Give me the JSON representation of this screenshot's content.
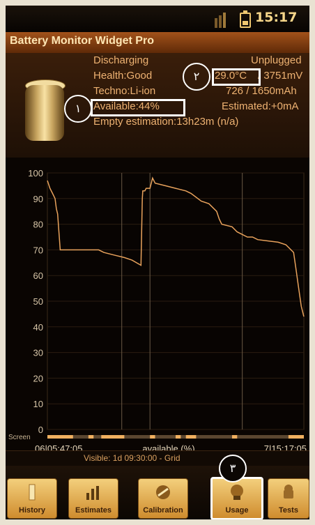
{
  "status": {
    "time": "15:17"
  },
  "app": {
    "title": "Battery Monitor Widget Pro"
  },
  "info": {
    "state": "Discharging",
    "plug": "Unplugged",
    "health": "Health:Good",
    "temperature": "29.0°C",
    "voltage": "/ 3751mV",
    "techno": "Techno:Li-ion",
    "capacity": "726 / 1650mAh",
    "available": "Available:44%",
    "estimated": "Estimated:+0mA",
    "empty_estimation": "Empty estimation:13h23m (n/a)"
  },
  "annotations": {
    "one": "١",
    "two": "٢",
    "three": "٣"
  },
  "chart_data": {
    "type": "line",
    "ylim": [
      0,
      100
    ],
    "y_ticks": [
      "0",
      "10",
      "20",
      "30",
      "40",
      "50",
      "60",
      "70",
      "80",
      "90",
      "100"
    ],
    "x_start_label": "06|05:47:05",
    "x_center_label": "available (%)",
    "x_end_label": "7|15:17:05",
    "row_label": "Screen",
    "x": [
      0,
      0.01,
      0.02,
      0.03,
      0.035,
      0.04,
      0.05,
      0.06,
      0.07,
      0.075,
      0.1,
      0.15,
      0.2,
      0.22,
      0.26,
      0.3,
      0.33,
      0.365,
      0.37,
      0.372,
      0.38,
      0.385,
      0.4,
      0.41,
      0.42,
      0.46,
      0.5,
      0.54,
      0.56,
      0.6,
      0.63,
      0.66,
      0.67,
      0.68,
      0.72,
      0.74,
      0.76,
      0.78,
      0.8,
      0.82,
      0.9,
      0.93,
      0.96,
      0.97,
      0.98,
      0.99,
      1.0
    ],
    "y": [
      97,
      94,
      92,
      90,
      86,
      84,
      70,
      70,
      70,
      70,
      70,
      70,
      70,
      69,
      68,
      67,
      66,
      64,
      90,
      93,
      93,
      94,
      94,
      98,
      96,
      95,
      94,
      93,
      92,
      89,
      88,
      85,
      82,
      80,
      79,
      77,
      76,
      75,
      75,
      74,
      73,
      72,
      69,
      62,
      55,
      48,
      44
    ],
    "series_color": "#e8a25c",
    "gridlines": true,
    "screen_segments": [
      [
        0.0,
        0.1
      ],
      [
        0.16,
        0.18
      ],
      [
        0.21,
        0.3
      ],
      [
        0.4,
        0.42
      ],
      [
        0.5,
        0.52
      ],
      [
        0.54,
        0.58
      ],
      [
        0.72,
        0.74
      ],
      [
        0.94,
        1.0
      ]
    ]
  },
  "footer": {
    "visible": "Visible: 1d 09:30:00 - Grid"
  },
  "tabs": [
    {
      "label": "History",
      "icon": "bar-icon"
    },
    {
      "label": "Estimates",
      "icon": "chart-icon"
    },
    {
      "label": "Calibration",
      "icon": "calibration-icon"
    },
    {
      "label": "Usage",
      "icon": "usage-icon"
    },
    {
      "label": "Tests",
      "icon": "android-icon"
    }
  ],
  "colors": {
    "accent": "#eeb272",
    "title": "#ffe6b4",
    "tab": "#e0a54a",
    "highlight": "#ffffff"
  }
}
